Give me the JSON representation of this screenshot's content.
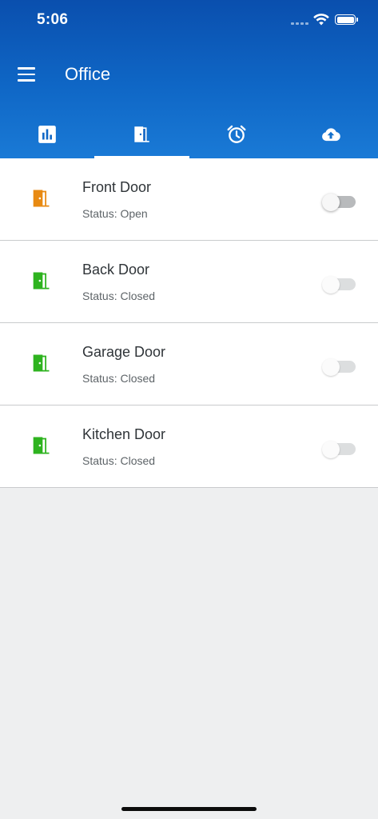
{
  "status_bar": {
    "time": "5:06"
  },
  "header": {
    "title": "Office"
  },
  "tabs": [
    {
      "icon": "bar-chart-icon",
      "active": false
    },
    {
      "icon": "door-icon",
      "active": true
    },
    {
      "icon": "alarm-clock-icon",
      "active": false
    },
    {
      "icon": "cloud-upload-icon",
      "active": false
    }
  ],
  "doors": [
    {
      "name": "Front Door",
      "status": "Status: Open",
      "icon_color": "#e88a12",
      "toggle_enabled": true
    },
    {
      "name": "Back Door",
      "status": "Status: Closed",
      "icon_color": "#2eb31f",
      "toggle_enabled": false
    },
    {
      "name": "Garage Door",
      "status": "Status: Closed",
      "icon_color": "#2eb31f",
      "toggle_enabled": false
    },
    {
      "name": "Kitchen Door",
      "status": "Status: Closed",
      "icon_color": "#2eb31f",
      "toggle_enabled": false
    }
  ],
  "colors": {
    "header": "#0f67c6",
    "open": "#e88a12",
    "closed": "#2eb31f"
  }
}
